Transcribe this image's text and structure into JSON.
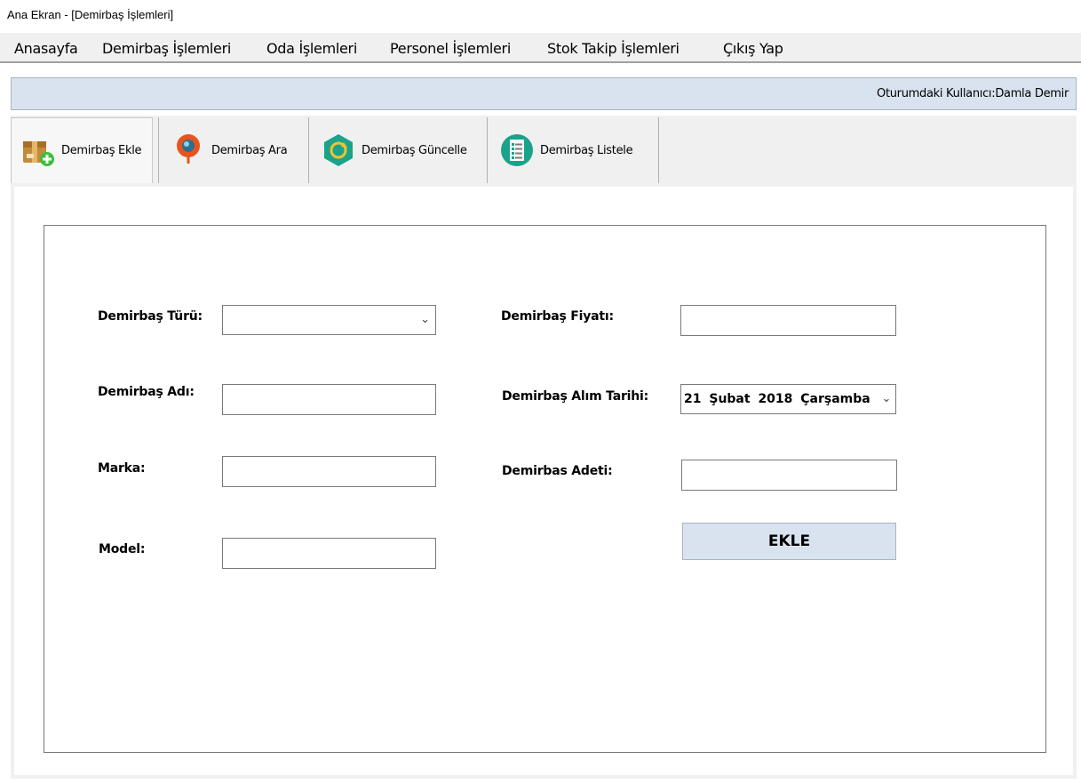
{
  "window": {
    "title": "Ana Ekran - [Demirbaş İşlemleri]"
  },
  "menu": {
    "items": [
      {
        "label": "Anasayfa"
      },
      {
        "label": "Demirbaş İşlemleri"
      },
      {
        "label": "Oda İşlemleri"
      },
      {
        "label": "Personel İşlemleri"
      },
      {
        "label": "Stok Takip İşlemleri"
      },
      {
        "label": "Çıkış Yap"
      }
    ]
  },
  "session": {
    "user_text": "Oturumdaki Kullanıcı:Damla Demir"
  },
  "toolbar": {
    "buttons": [
      {
        "label": "Demirbaş Ekle",
        "icon": "box-add-icon",
        "active": true
      },
      {
        "label": "Demirbaş Ara",
        "icon": "search-pin-icon"
      },
      {
        "label": "Demirbaş Güncelle",
        "icon": "refresh-hexagon-icon"
      },
      {
        "label": "Demirbaş Listele",
        "icon": "list-document-icon"
      }
    ]
  },
  "form": {
    "tur_label": "Demirbaş Türü:",
    "tur_value": "",
    "ad_label": "Demirbaş Adı:",
    "ad_value": "",
    "marka_label": "Marka:",
    "marka_value": "",
    "model_label": "Model:",
    "model_value": "",
    "fiyat_label": "Demirbaş Fiyatı:",
    "fiyat_value": "",
    "tarih_label": "Demirbaş Alım Tarihi:",
    "tarih_value": "21  Şubat  2018 Çarşamba",
    "adet_label": "Demirbas Adeti:",
    "adet_value": "",
    "submit_label": "EKLE"
  },
  "colors": {
    "accent_bar": "#d9e3ef",
    "toolbar_bg": "#f0f0f0",
    "icon_orange": "#e8541c",
    "icon_teal": "#1aa38a"
  }
}
